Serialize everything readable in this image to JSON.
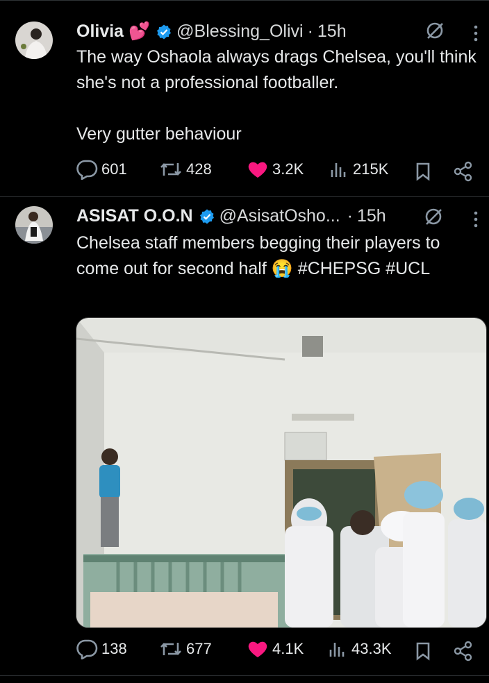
{
  "tweets": [
    {
      "name": "Olivia 💕",
      "handle": "@Blessing_Olivi",
      "sep": "·",
      "time": "15h",
      "text": "The way Oshaola always drags Chelsea, you'll think she's not a professional footballer.\n\nVery gutter behaviour",
      "replies": "601",
      "reposts": "428",
      "likes": "3.2K",
      "views": "215K"
    },
    {
      "name": "ASISAT O.O.N",
      "handle": "@AsisatOsho...",
      "sep": "·",
      "time": "15h",
      "text": "Chelsea staff members begging their players to come out for second half 😭 #CHEPSG #UCL",
      "replies": "138",
      "reposts": "677",
      "likes": "4.1K",
      "views": "43.3K"
    }
  ],
  "colors": {
    "like": "#f91880",
    "verified": "#1d9bf0",
    "text": "#e7e9ea",
    "border": "#2f3336"
  },
  "icons": [
    "reply-icon",
    "repost-icon",
    "heart-icon",
    "views-icon",
    "bookmark-icon",
    "share-icon",
    "grok-icon",
    "more-icon",
    "verified-icon"
  ]
}
